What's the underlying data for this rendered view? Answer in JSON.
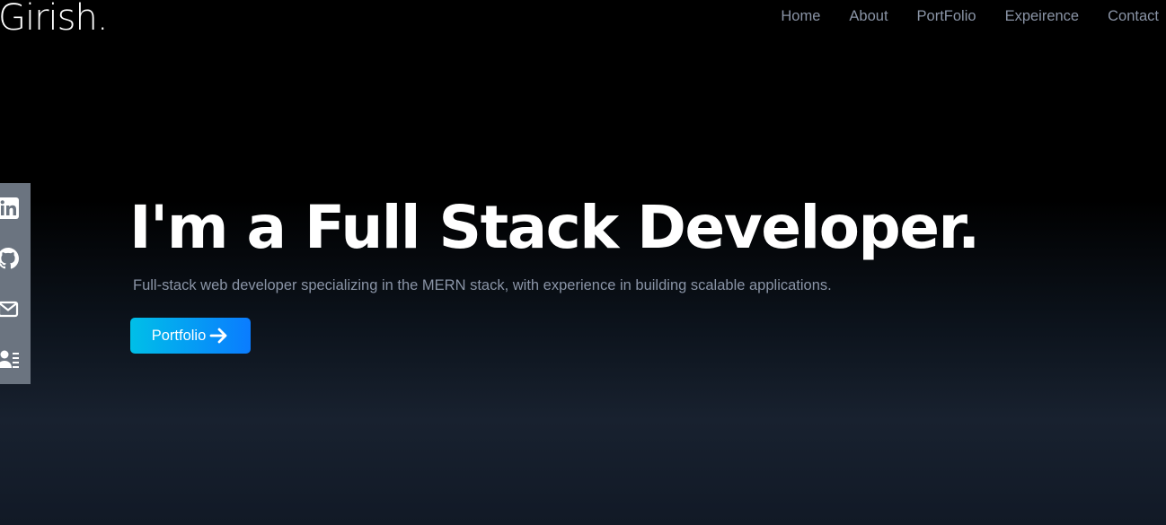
{
  "brand": {
    "logo": "Girish."
  },
  "nav": {
    "items": [
      {
        "label": "Home"
      },
      {
        "label": "About"
      },
      {
        "label": "PortFolio"
      },
      {
        "label": "Expeirence"
      },
      {
        "label": "Contact"
      }
    ]
  },
  "social": {
    "icons": [
      "linkedin-icon",
      "github-icon",
      "mail-icon",
      "resume-icon"
    ]
  },
  "hero": {
    "title": "I'm a Full Stack Developer.",
    "subtitle": "Full-stack web developer specializing in the MERN stack, with experience in building scalable applications.",
    "cta_label": "Portfolio",
    "cta_icon": "arrow-right-icon"
  },
  "colors": {
    "nav_text": "#8a94a6",
    "social_bar": "#6b7480",
    "cta_start": "#00bfe8",
    "cta_end": "#0a7cff"
  }
}
